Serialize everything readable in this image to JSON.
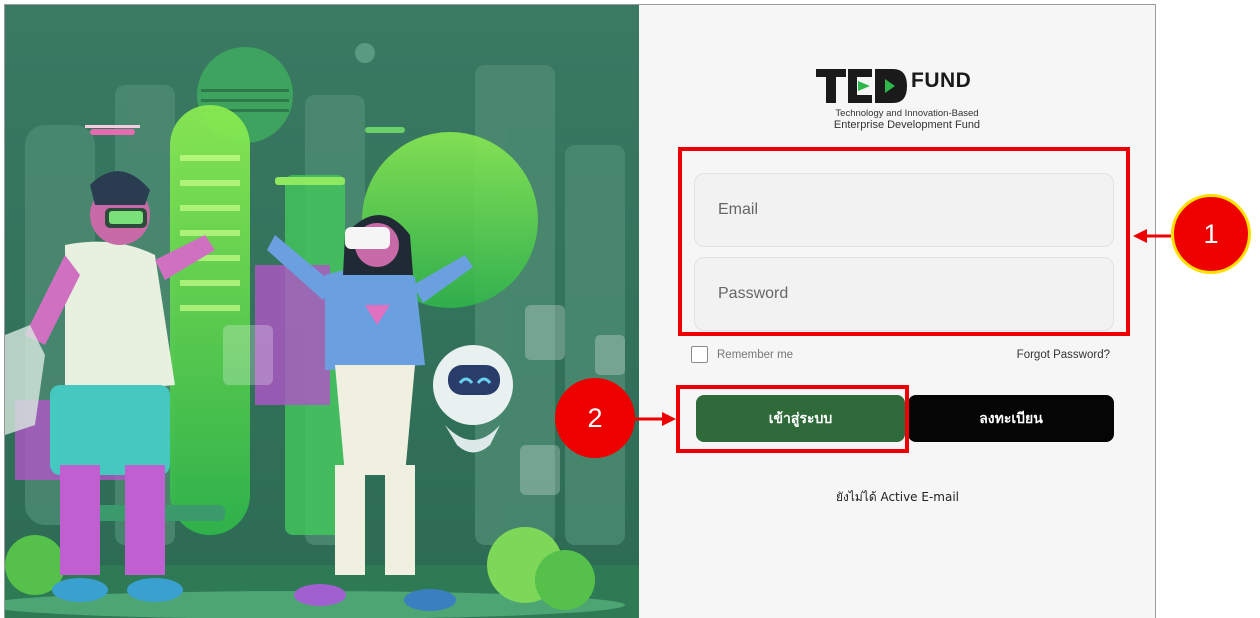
{
  "logo": {
    "brand_word": "FUND",
    "subtitle_line1": "Technology and Innovation-Based",
    "subtitle_line2": "Enterprise Development Fund"
  },
  "form": {
    "email_placeholder": "Email",
    "password_placeholder": "Password",
    "remember_label": "Remember me",
    "forgot_label": "Forgot Password?",
    "login_label": "เข้าสู่ระบบ",
    "register_label": "ลงทะเบียน",
    "activate_label": "ยังไม่ได้ Active E-mail"
  },
  "annotations": {
    "callout_1": "1",
    "callout_2": "2"
  },
  "colors": {
    "login_button": "#2e6a3a",
    "register_button": "#050505",
    "highlight": "#ee0000",
    "callout_ring": "#ffe000"
  },
  "hero_icons": [
    "city-illustration",
    "vr-headset-man",
    "vr-headset-woman",
    "robot-mascot",
    "drone-icon"
  ]
}
